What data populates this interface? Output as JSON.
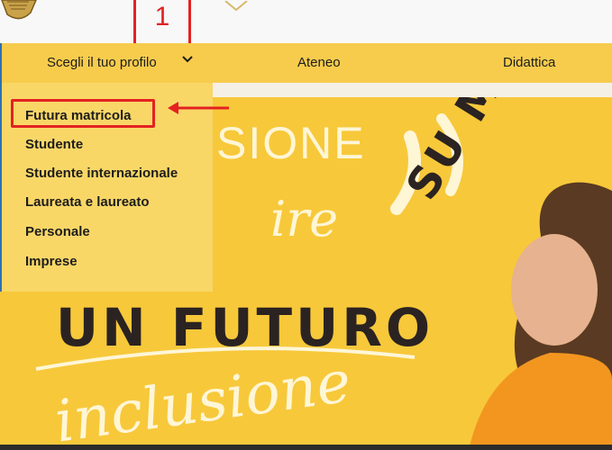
{
  "annotation": {
    "step_number": "1"
  },
  "nav": {
    "profile_label": "Scegli il tuo profilo",
    "items": [
      "Ateneo",
      "Didattica"
    ]
  },
  "dropdown": {
    "items": [
      "Futura matricola",
      "Studente",
      "Studente internazionale",
      "Laureata e laureato",
      "Personale",
      "Imprese"
    ]
  },
  "hero": {
    "lines": [
      "SIONE",
      "ire",
      "UN FUTURO",
      "SU MISURA",
      "inclusione"
    ]
  },
  "colors": {
    "accent_yellow": "#f7cc4d",
    "highlight_red": "#e32222",
    "text_dark": "#1d1d1d"
  }
}
